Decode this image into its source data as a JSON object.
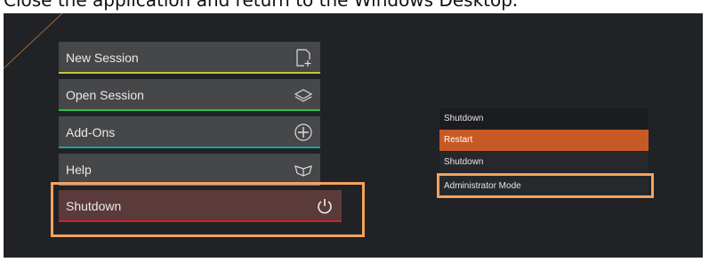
{
  "caption": "Close the application and return to the Windows Desktop.",
  "colors": {
    "screen_bg": "#202226",
    "button_bg": "#464749",
    "shutdown_bg": "#5a3a3a",
    "highlight": "#f4a25c",
    "restart": "#c75a24",
    "bar_new": "#c8c830",
    "bar_open": "#2fbf4a",
    "bar_addons": "#1fa2a0",
    "bar_help": "#4d7fd9",
    "bar_shutdown": "#d12424"
  },
  "menu": {
    "new_session": {
      "label": "New Session",
      "icon": "new-document-icon"
    },
    "open_session": {
      "label": "Open Session",
      "icon": "layers-icon"
    },
    "add_ons": {
      "label": "Add-Ons",
      "icon": "plus-circle-icon"
    },
    "help": {
      "label": "Help",
      "icon": "book-icon"
    },
    "shutdown": {
      "label": "Shutdown",
      "icon": "power-icon"
    }
  },
  "dropdown": {
    "header": "Shutdown",
    "items": [
      "Restart",
      "Shutdown",
      "Administrator Mode"
    ],
    "selected": "Restart"
  }
}
